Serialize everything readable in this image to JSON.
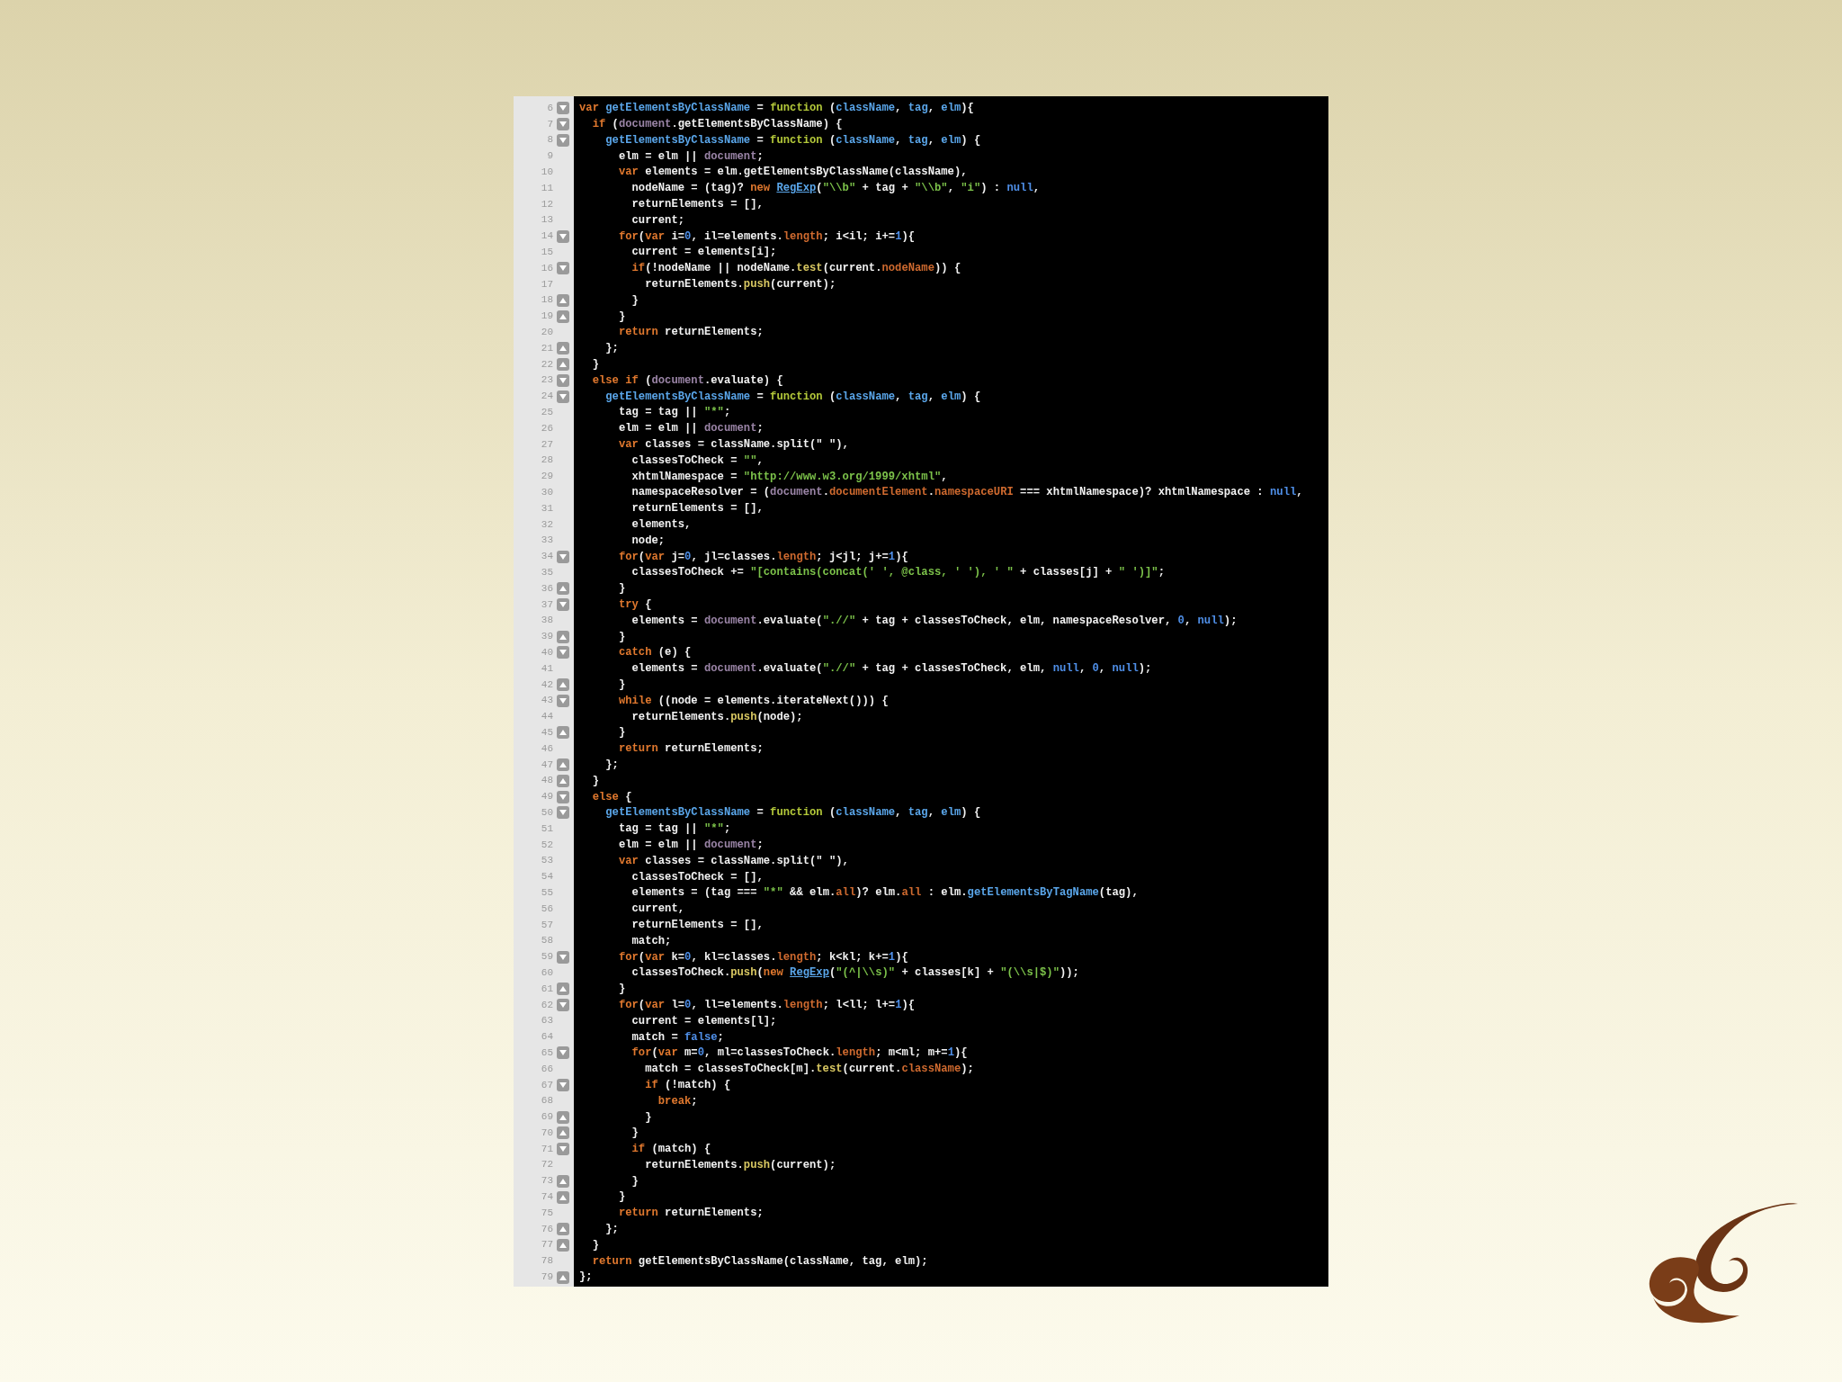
{
  "editor": {
    "lines": [
      {
        "number": "6",
        "fold_start": true,
        "fold_end": false,
        "segments": [
          {
            "kind": "keyword",
            "text": "var "
          },
          {
            "kind": "name",
            "text": "getElementsByClassName"
          },
          {
            "kind": "plain",
            "text": " = "
          },
          {
            "kind": "function",
            "text": "function"
          },
          {
            "kind": "plain",
            "text": " ("
          },
          {
            "kind": "name",
            "text": "className"
          },
          {
            "kind": "plain",
            "text": ", "
          },
          {
            "kind": "name",
            "text": "tag"
          },
          {
            "kind": "plain",
            "text": ", "
          },
          {
            "kind": "name",
            "text": "elm"
          },
          {
            "kind": "plain",
            "text": "){"
          }
        ]
      },
      {
        "number": "7",
        "fold_start": true,
        "fold_end": false,
        "segments": [
          {
            "kind": "keyword",
            "text": "  if"
          },
          {
            "kind": "plain",
            "text": " ("
          },
          {
            "kind": "global",
            "text": "document"
          },
          {
            "kind": "plain",
            "text": ".getElementsByClassName) {"
          }
        ]
      },
      {
        "number": "8",
        "fold_start": true,
        "fold_end": false,
        "segments": [
          {
            "kind": "name",
            "text": "    getElementsByClassName"
          },
          {
            "kind": "plain",
            "text": " = "
          },
          {
            "kind": "function",
            "text": "function"
          },
          {
            "kind": "plain",
            "text": " ("
          },
          {
            "kind": "name",
            "text": "className"
          },
          {
            "kind": "plain",
            "text": ", "
          },
          {
            "kind": "name",
            "text": "tag"
          },
          {
            "kind": "plain",
            "text": ", "
          },
          {
            "kind": "name",
            "text": "elm"
          },
          {
            "kind": "plain",
            "text": ") {"
          }
        ]
      },
      {
        "number": "9",
        "fold_start": false,
        "fold_end": false,
        "segments": [
          {
            "kind": "plain",
            "text": "      elm = elm || "
          },
          {
            "kind": "global",
            "text": "document"
          },
          {
            "kind": "plain",
            "text": ";"
          }
        ]
      },
      {
        "number": "10",
        "fold_start": false,
        "fold_end": false,
        "segments": [
          {
            "kind": "keyword",
            "text": "      var"
          },
          {
            "kind": "plain",
            "text": " elements = elm.getElementsByClassName(className),"
          }
        ]
      },
      {
        "number": "11",
        "fold_start": false,
        "fold_end": false,
        "segments": [
          {
            "kind": "plain",
            "text": "        nodeName = (tag)? "
          },
          {
            "kind": "keyword",
            "text": "new "
          },
          {
            "kind": "link",
            "text": "RegExp"
          },
          {
            "kind": "plain",
            "text": "("
          },
          {
            "kind": "string",
            "text": "\"\\\\b\""
          },
          {
            "kind": "plain",
            "text": " + tag + "
          },
          {
            "kind": "string",
            "text": "\"\\\\b\""
          },
          {
            "kind": "plain",
            "text": ", "
          },
          {
            "kind": "string",
            "text": "\"i\""
          },
          {
            "kind": "plain",
            "text": ") : "
          },
          {
            "kind": "number",
            "text": "null"
          },
          {
            "kind": "plain",
            "text": ","
          }
        ]
      },
      {
        "number": "12",
        "fold_start": false,
        "fold_end": false,
        "segments": [
          {
            "kind": "plain",
            "text": "        returnElements = [],"
          }
        ]
      },
      {
        "number": "13",
        "fold_start": false,
        "fold_end": false,
        "segments": [
          {
            "kind": "plain",
            "text": "        current;"
          }
        ]
      },
      {
        "number": "14",
        "fold_start": true,
        "fold_end": false,
        "segments": [
          {
            "kind": "keyword",
            "text": "      for"
          },
          {
            "kind": "plain",
            "text": "("
          },
          {
            "kind": "keyword",
            "text": "var"
          },
          {
            "kind": "plain",
            "text": " i="
          },
          {
            "kind": "number",
            "text": "0"
          },
          {
            "kind": "plain",
            "text": ", il=elements."
          },
          {
            "kind": "property",
            "text": "length"
          },
          {
            "kind": "plain",
            "text": "; i<il; i+="
          },
          {
            "kind": "number",
            "text": "1"
          },
          {
            "kind": "plain",
            "text": "){"
          }
        ]
      },
      {
        "number": "15",
        "fold_start": false,
        "fold_end": false,
        "segments": [
          {
            "kind": "plain",
            "text": "        current = elements[i];"
          }
        ]
      },
      {
        "number": "16",
        "fold_start": true,
        "fold_end": false,
        "segments": [
          {
            "kind": "keyword",
            "text": "        if"
          },
          {
            "kind": "plain",
            "text": "(!nodeName || nodeName."
          },
          {
            "kind": "method",
            "text": "test"
          },
          {
            "kind": "plain",
            "text": "(current."
          },
          {
            "kind": "property",
            "text": "nodeName"
          },
          {
            "kind": "plain",
            "text": ")) {"
          }
        ]
      },
      {
        "number": "17",
        "fold_start": false,
        "fold_end": false,
        "segments": [
          {
            "kind": "plain",
            "text": "          returnElements."
          },
          {
            "kind": "method",
            "text": "push"
          },
          {
            "kind": "plain",
            "text": "(current);"
          }
        ]
      },
      {
        "number": "18",
        "fold_start": false,
        "fold_end": true,
        "segments": [
          {
            "kind": "plain",
            "text": "        }"
          }
        ]
      },
      {
        "number": "19",
        "fold_start": false,
        "fold_end": true,
        "segments": [
          {
            "kind": "plain",
            "text": "      }"
          }
        ]
      },
      {
        "number": "20",
        "fold_start": false,
        "fold_end": false,
        "segments": [
          {
            "kind": "keyword",
            "text": "      return"
          },
          {
            "kind": "plain",
            "text": " returnElements;"
          }
        ]
      },
      {
        "number": "21",
        "fold_start": false,
        "fold_end": true,
        "segments": [
          {
            "kind": "plain",
            "text": "    };"
          }
        ]
      },
      {
        "number": "22",
        "fold_start": false,
        "fold_end": true,
        "segments": [
          {
            "kind": "plain",
            "text": "  }"
          }
        ]
      },
      {
        "number": "23",
        "fold_start": true,
        "fold_end": false,
        "segments": [
          {
            "kind": "keyword",
            "text": "  else if"
          },
          {
            "kind": "plain",
            "text": " ("
          },
          {
            "kind": "global",
            "text": "document"
          },
          {
            "kind": "plain",
            "text": ".evaluate) {"
          }
        ]
      },
      {
        "number": "24",
        "fold_start": true,
        "fold_end": false,
        "segments": [
          {
            "kind": "name",
            "text": "    getElementsByClassName"
          },
          {
            "kind": "plain",
            "text": " = "
          },
          {
            "kind": "function",
            "text": "function"
          },
          {
            "kind": "plain",
            "text": " ("
          },
          {
            "kind": "name",
            "text": "className"
          },
          {
            "kind": "plain",
            "text": ", "
          },
          {
            "kind": "name",
            "text": "tag"
          },
          {
            "kind": "plain",
            "text": ", "
          },
          {
            "kind": "name",
            "text": "elm"
          },
          {
            "kind": "plain",
            "text": ") {"
          }
        ]
      },
      {
        "number": "25",
        "fold_start": false,
        "fold_end": false,
        "segments": [
          {
            "kind": "plain",
            "text": "      tag = tag || "
          },
          {
            "kind": "string",
            "text": "\"*\""
          },
          {
            "kind": "plain",
            "text": ";"
          }
        ]
      },
      {
        "number": "26",
        "fold_start": false,
        "fold_end": false,
        "segments": [
          {
            "kind": "plain",
            "text": "      elm = elm || "
          },
          {
            "kind": "global",
            "text": "document"
          },
          {
            "kind": "plain",
            "text": ";"
          }
        ]
      },
      {
        "number": "27",
        "fold_start": false,
        "fold_end": false,
        "segments": [
          {
            "kind": "keyword",
            "text": "      var"
          },
          {
            "kind": "plain",
            "text": " classes = className.split(\" \"),"
          }
        ]
      },
      {
        "number": "28",
        "fold_start": false,
        "fold_end": false,
        "segments": [
          {
            "kind": "plain",
            "text": "        classesToCheck = "
          },
          {
            "kind": "string",
            "text": "\"\""
          },
          {
            "kind": "plain",
            "text": ","
          }
        ]
      },
      {
        "number": "29",
        "fold_start": false,
        "fold_end": false,
        "segments": [
          {
            "kind": "plain",
            "text": "        xhtmlNamespace = "
          },
          {
            "kind": "string",
            "text": "\"http://www.w3.org/1999/xhtml\""
          },
          {
            "kind": "plain",
            "text": ","
          }
        ]
      },
      {
        "number": "30",
        "fold_start": false,
        "fold_end": false,
        "segments": [
          {
            "kind": "plain",
            "text": "        namespaceResolver = ("
          },
          {
            "kind": "global",
            "text": "document"
          },
          {
            "kind": "plain",
            "text": "."
          },
          {
            "kind": "property",
            "text": "documentElement"
          },
          {
            "kind": "plain",
            "text": "."
          },
          {
            "kind": "property",
            "text": "namespaceURI"
          },
          {
            "kind": "plain",
            "text": " === xhtmlNamespace)? xhtmlNamespace : "
          },
          {
            "kind": "number",
            "text": "null"
          },
          {
            "kind": "plain",
            "text": ","
          }
        ]
      },
      {
        "number": "31",
        "fold_start": false,
        "fold_end": false,
        "segments": [
          {
            "kind": "plain",
            "text": "        returnElements = [],"
          }
        ]
      },
      {
        "number": "32",
        "fold_start": false,
        "fold_end": false,
        "segments": [
          {
            "kind": "plain",
            "text": "        elements,"
          }
        ]
      },
      {
        "number": "33",
        "fold_start": false,
        "fold_end": false,
        "segments": [
          {
            "kind": "plain",
            "text": "        node;"
          }
        ]
      },
      {
        "number": "34",
        "fold_start": true,
        "fold_end": false,
        "segments": [
          {
            "kind": "keyword",
            "text": "      for"
          },
          {
            "kind": "plain",
            "text": "("
          },
          {
            "kind": "keyword",
            "text": "var"
          },
          {
            "kind": "plain",
            "text": " j="
          },
          {
            "kind": "number",
            "text": "0"
          },
          {
            "kind": "plain",
            "text": ", jl=classes."
          },
          {
            "kind": "property",
            "text": "length"
          },
          {
            "kind": "plain",
            "text": "; j<jl; j+="
          },
          {
            "kind": "number",
            "text": "1"
          },
          {
            "kind": "plain",
            "text": "){"
          }
        ]
      },
      {
        "number": "35",
        "fold_start": false,
        "fold_end": false,
        "segments": [
          {
            "kind": "plain",
            "text": "        classesToCheck += "
          },
          {
            "kind": "string",
            "text": "\"[contains(concat(' ', @class, ' '), ' \""
          },
          {
            "kind": "plain",
            "text": " + classes[j] + "
          },
          {
            "kind": "string",
            "text": "\" ')]\""
          },
          {
            "kind": "plain",
            "text": ";"
          }
        ]
      },
      {
        "number": "36",
        "fold_start": false,
        "fold_end": true,
        "segments": [
          {
            "kind": "plain",
            "text": "      }"
          }
        ]
      },
      {
        "number": "37",
        "fold_start": true,
        "fold_end": false,
        "segments": [
          {
            "kind": "keyword",
            "text": "      try"
          },
          {
            "kind": "plain",
            "text": " {"
          }
        ]
      },
      {
        "number": "38",
        "fold_start": false,
        "fold_end": false,
        "segments": [
          {
            "kind": "plain",
            "text": "        elements = "
          },
          {
            "kind": "global",
            "text": "document"
          },
          {
            "kind": "plain",
            "text": ".evaluate("
          },
          {
            "kind": "string",
            "text": "\".//\""
          },
          {
            "kind": "plain",
            "text": " + tag + classesToCheck, elm, namespaceResolver, "
          },
          {
            "kind": "number",
            "text": "0"
          },
          {
            "kind": "plain",
            "text": ", "
          },
          {
            "kind": "number",
            "text": "null"
          },
          {
            "kind": "plain",
            "text": ");"
          }
        ]
      },
      {
        "number": "39",
        "fold_start": false,
        "fold_end": true,
        "segments": [
          {
            "kind": "plain",
            "text": "      }"
          }
        ]
      },
      {
        "number": "40",
        "fold_start": true,
        "fold_end": false,
        "segments": [
          {
            "kind": "keyword",
            "text": "      catch"
          },
          {
            "kind": "plain",
            "text": " (e) {"
          }
        ]
      },
      {
        "number": "41",
        "fold_start": false,
        "fold_end": false,
        "segments": [
          {
            "kind": "plain",
            "text": "        elements = "
          },
          {
            "kind": "global",
            "text": "document"
          },
          {
            "kind": "plain",
            "text": ".evaluate("
          },
          {
            "kind": "string",
            "text": "\".//\""
          },
          {
            "kind": "plain",
            "text": " + tag + classesToCheck, elm, "
          },
          {
            "kind": "number",
            "text": "null"
          },
          {
            "kind": "plain",
            "text": ", "
          },
          {
            "kind": "number",
            "text": "0"
          },
          {
            "kind": "plain",
            "text": ", "
          },
          {
            "kind": "number",
            "text": "null"
          },
          {
            "kind": "plain",
            "text": ");"
          }
        ]
      },
      {
        "number": "42",
        "fold_start": false,
        "fold_end": true,
        "segments": [
          {
            "kind": "plain",
            "text": "      }"
          }
        ]
      },
      {
        "number": "43",
        "fold_start": true,
        "fold_end": false,
        "segments": [
          {
            "kind": "keyword",
            "text": "      while"
          },
          {
            "kind": "plain",
            "text": " ((node = elements.iterateNext())) {"
          }
        ]
      },
      {
        "number": "44",
        "fold_start": false,
        "fold_end": false,
        "segments": [
          {
            "kind": "plain",
            "text": "        returnElements."
          },
          {
            "kind": "method",
            "text": "push"
          },
          {
            "kind": "plain",
            "text": "(node);"
          }
        ]
      },
      {
        "number": "45",
        "fold_start": false,
        "fold_end": true,
        "segments": [
          {
            "kind": "plain",
            "text": "      }"
          }
        ]
      },
      {
        "number": "46",
        "fold_start": false,
        "fold_end": false,
        "segments": [
          {
            "kind": "keyword",
            "text": "      return"
          },
          {
            "kind": "plain",
            "text": " returnElements;"
          }
        ]
      },
      {
        "number": "47",
        "fold_start": false,
        "fold_end": true,
        "segments": [
          {
            "kind": "plain",
            "text": "    };"
          }
        ]
      },
      {
        "number": "48",
        "fold_start": false,
        "fold_end": true,
        "segments": [
          {
            "kind": "plain",
            "text": "  }"
          }
        ]
      },
      {
        "number": "49",
        "fold_start": true,
        "fold_end": false,
        "segments": [
          {
            "kind": "keyword",
            "text": "  else"
          },
          {
            "kind": "plain",
            "text": " {"
          }
        ]
      },
      {
        "number": "50",
        "fold_start": true,
        "fold_end": false,
        "segments": [
          {
            "kind": "name",
            "text": "    getElementsByClassName"
          },
          {
            "kind": "plain",
            "text": " = "
          },
          {
            "kind": "function",
            "text": "function"
          },
          {
            "kind": "plain",
            "text": " ("
          },
          {
            "kind": "name",
            "text": "className"
          },
          {
            "kind": "plain",
            "text": ", "
          },
          {
            "kind": "name",
            "text": "tag"
          },
          {
            "kind": "plain",
            "text": ", "
          },
          {
            "kind": "name",
            "text": "elm"
          },
          {
            "kind": "plain",
            "text": ") {"
          }
        ]
      },
      {
        "number": "51",
        "fold_start": false,
        "fold_end": false,
        "segments": [
          {
            "kind": "plain",
            "text": "      tag = tag || "
          },
          {
            "kind": "string",
            "text": "\"*\""
          },
          {
            "kind": "plain",
            "text": ";"
          }
        ]
      },
      {
        "number": "52",
        "fold_start": false,
        "fold_end": false,
        "segments": [
          {
            "kind": "plain",
            "text": "      elm = elm || "
          },
          {
            "kind": "global",
            "text": "document"
          },
          {
            "kind": "plain",
            "text": ";"
          }
        ]
      },
      {
        "number": "53",
        "fold_start": false,
        "fold_end": false,
        "segments": [
          {
            "kind": "keyword",
            "text": "      var"
          },
          {
            "kind": "plain",
            "text": " classes = className.split(\" \"),"
          }
        ]
      },
      {
        "number": "54",
        "fold_start": false,
        "fold_end": false,
        "segments": [
          {
            "kind": "plain",
            "text": "        classesToCheck = [],"
          }
        ]
      },
      {
        "number": "55",
        "fold_start": false,
        "fold_end": false,
        "segments": [
          {
            "kind": "plain",
            "text": "        elements = (tag === "
          },
          {
            "kind": "string",
            "text": "\"*\""
          },
          {
            "kind": "plain",
            "text": " && elm."
          },
          {
            "kind": "property",
            "text": "all"
          },
          {
            "kind": "plain",
            "text": ")? elm."
          },
          {
            "kind": "property",
            "text": "all"
          },
          {
            "kind": "plain",
            "text": " : elm."
          },
          {
            "kind": "name",
            "text": "getElementsByTagName"
          },
          {
            "kind": "plain",
            "text": "(tag),"
          }
        ]
      },
      {
        "number": "56",
        "fold_start": false,
        "fold_end": false,
        "segments": [
          {
            "kind": "plain",
            "text": "        current,"
          }
        ]
      },
      {
        "number": "57",
        "fold_start": false,
        "fold_end": false,
        "segments": [
          {
            "kind": "plain",
            "text": "        returnElements = [],"
          }
        ]
      },
      {
        "number": "58",
        "fold_start": false,
        "fold_end": false,
        "segments": [
          {
            "kind": "plain",
            "text": "        match;"
          }
        ]
      },
      {
        "number": "59",
        "fold_start": true,
        "fold_end": false,
        "segments": [
          {
            "kind": "keyword",
            "text": "      for"
          },
          {
            "kind": "plain",
            "text": "("
          },
          {
            "kind": "keyword",
            "text": "var"
          },
          {
            "kind": "plain",
            "text": " k="
          },
          {
            "kind": "number",
            "text": "0"
          },
          {
            "kind": "plain",
            "text": ", kl=classes."
          },
          {
            "kind": "property",
            "text": "length"
          },
          {
            "kind": "plain",
            "text": "; k<kl; k+="
          },
          {
            "kind": "number",
            "text": "1"
          },
          {
            "kind": "plain",
            "text": "){"
          }
        ]
      },
      {
        "number": "60",
        "fold_start": false,
        "fold_end": false,
        "segments": [
          {
            "kind": "plain",
            "text": "        classesToCheck."
          },
          {
            "kind": "method",
            "text": "push"
          },
          {
            "kind": "plain",
            "text": "("
          },
          {
            "kind": "keyword",
            "text": "new "
          },
          {
            "kind": "link",
            "text": "RegExp"
          },
          {
            "kind": "plain",
            "text": "("
          },
          {
            "kind": "string",
            "text": "\"(^|\\\\s)\""
          },
          {
            "kind": "plain",
            "text": " + classes[k] + "
          },
          {
            "kind": "string",
            "text": "\"(\\\\s|$)\""
          },
          {
            "kind": "plain",
            "text": "));"
          }
        ]
      },
      {
        "number": "61",
        "fold_start": false,
        "fold_end": true,
        "segments": [
          {
            "kind": "plain",
            "text": "      }"
          }
        ]
      },
      {
        "number": "62",
        "fold_start": true,
        "fold_end": false,
        "segments": [
          {
            "kind": "keyword",
            "text": "      for"
          },
          {
            "kind": "plain",
            "text": "("
          },
          {
            "kind": "keyword",
            "text": "var"
          },
          {
            "kind": "plain",
            "text": " l="
          },
          {
            "kind": "number",
            "text": "0"
          },
          {
            "kind": "plain",
            "text": ", ll=elements."
          },
          {
            "kind": "property",
            "text": "length"
          },
          {
            "kind": "plain",
            "text": "; l<ll; l+="
          },
          {
            "kind": "number",
            "text": "1"
          },
          {
            "kind": "plain",
            "text": "){"
          }
        ]
      },
      {
        "number": "63",
        "fold_start": false,
        "fold_end": false,
        "segments": [
          {
            "kind": "plain",
            "text": "        current = elements[l];"
          }
        ]
      },
      {
        "number": "64",
        "fold_start": false,
        "fold_end": false,
        "segments": [
          {
            "kind": "plain",
            "text": "        match = "
          },
          {
            "kind": "number",
            "text": "false"
          },
          {
            "kind": "plain",
            "text": ";"
          }
        ]
      },
      {
        "number": "65",
        "fold_start": true,
        "fold_end": false,
        "segments": [
          {
            "kind": "keyword",
            "text": "        for"
          },
          {
            "kind": "plain",
            "text": "("
          },
          {
            "kind": "keyword",
            "text": "var"
          },
          {
            "kind": "plain",
            "text": " m="
          },
          {
            "kind": "number",
            "text": "0"
          },
          {
            "kind": "plain",
            "text": ", ml=classesToCheck."
          },
          {
            "kind": "property",
            "text": "length"
          },
          {
            "kind": "plain",
            "text": "; m<ml; m+="
          },
          {
            "kind": "number",
            "text": "1"
          },
          {
            "kind": "plain",
            "text": "){"
          }
        ]
      },
      {
        "number": "66",
        "fold_start": false,
        "fold_end": false,
        "segments": [
          {
            "kind": "plain",
            "text": "          match = classesToCheck[m]."
          },
          {
            "kind": "method",
            "text": "test"
          },
          {
            "kind": "plain",
            "text": "(current."
          },
          {
            "kind": "property",
            "text": "className"
          },
          {
            "kind": "plain",
            "text": ");"
          }
        ]
      },
      {
        "number": "67",
        "fold_start": true,
        "fold_end": false,
        "segments": [
          {
            "kind": "keyword",
            "text": "          if"
          },
          {
            "kind": "plain",
            "text": " (!match) {"
          }
        ]
      },
      {
        "number": "68",
        "fold_start": false,
        "fold_end": false,
        "segments": [
          {
            "kind": "keyword",
            "text": "            break"
          },
          {
            "kind": "plain",
            "text": ";"
          }
        ]
      },
      {
        "number": "69",
        "fold_start": false,
        "fold_end": true,
        "segments": [
          {
            "kind": "plain",
            "text": "          }"
          }
        ]
      },
      {
        "number": "70",
        "fold_start": false,
        "fold_end": true,
        "segments": [
          {
            "kind": "plain",
            "text": "        }"
          }
        ]
      },
      {
        "number": "71",
        "fold_start": true,
        "fold_end": false,
        "segments": [
          {
            "kind": "keyword",
            "text": "        if"
          },
          {
            "kind": "plain",
            "text": " (match) {"
          }
        ]
      },
      {
        "number": "72",
        "fold_start": false,
        "fold_end": false,
        "segments": [
          {
            "kind": "plain",
            "text": "          returnElements."
          },
          {
            "kind": "method",
            "text": "push"
          },
          {
            "kind": "plain",
            "text": "(current);"
          }
        ]
      },
      {
        "number": "73",
        "fold_start": false,
        "fold_end": true,
        "segments": [
          {
            "kind": "plain",
            "text": "        }"
          }
        ]
      },
      {
        "number": "74",
        "fold_start": false,
        "fold_end": true,
        "segments": [
          {
            "kind": "plain",
            "text": "      }"
          }
        ]
      },
      {
        "number": "75",
        "fold_start": false,
        "fold_end": false,
        "segments": [
          {
            "kind": "keyword",
            "text": "      return"
          },
          {
            "kind": "plain",
            "text": " returnElements;"
          }
        ]
      },
      {
        "number": "76",
        "fold_start": false,
        "fold_end": true,
        "segments": [
          {
            "kind": "plain",
            "text": "    };"
          }
        ]
      },
      {
        "number": "77",
        "fold_start": false,
        "fold_end": true,
        "segments": [
          {
            "kind": "plain",
            "text": "  }"
          }
        ]
      },
      {
        "number": "78",
        "fold_start": false,
        "fold_end": false,
        "segments": [
          {
            "kind": "keyword",
            "text": "  return"
          },
          {
            "kind": "plain",
            "text": " getElementsByClassName(className, tag, elm);"
          }
        ]
      },
      {
        "number": "79",
        "fold_start": false,
        "fold_end": true,
        "segments": [
          {
            "kind": "plain",
            "text": "};"
          }
        ]
      }
    ]
  }
}
